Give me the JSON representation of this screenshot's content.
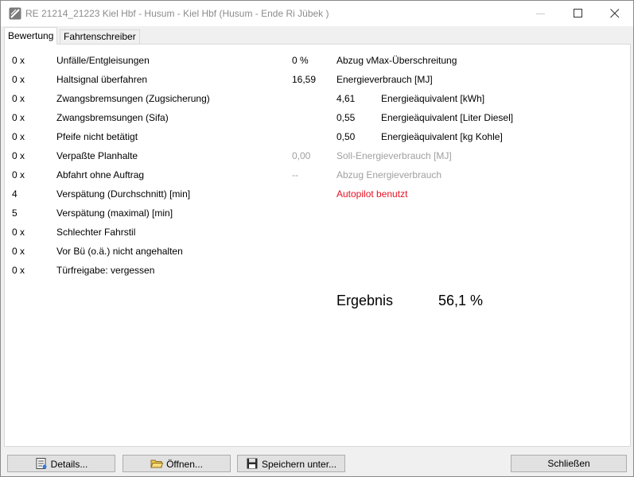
{
  "window": {
    "title": "RE 21214_21223 Kiel Hbf - Husum - Kiel Hbf (Husum - Ende Ri Jübek )"
  },
  "tabs": [
    {
      "label": "Bewertung"
    },
    {
      "label": "Fahrtenschreiber"
    }
  ],
  "left_rows": [
    {
      "value": "0 x",
      "label": "Unfälle/Entgleisungen"
    },
    {
      "value": "0 x",
      "label": "Haltsignal überfahren"
    },
    {
      "value": "0 x",
      "label": "Zwangsbremsungen (Zugsicherung)"
    },
    {
      "value": "0 x",
      "label": "Zwangsbremsungen (Sifa)"
    },
    {
      "value": "0 x",
      "label": "Pfeife nicht betätigt"
    },
    {
      "value": "0 x",
      "label": "Verpaßte Planhalte"
    },
    {
      "value": "0 x",
      "label": "Abfahrt ohne Auftrag"
    },
    {
      "value": "4",
      "label": "Verspätung (Durchschnitt) [min]"
    },
    {
      "value": "5",
      "label": "Verspätung (maximal) [min]"
    },
    {
      "value": "0 x",
      "label": "Schlechter Fahrstil"
    },
    {
      "value": "0 x",
      "label": "Vor Bü (o.ä.) nicht angehalten"
    },
    {
      "value": "0 x",
      "label": "Türfreigabe: vergessen"
    }
  ],
  "right": {
    "vmax": {
      "value": "0 %",
      "label": "Abzug vMax-Überschreitung"
    },
    "energy": {
      "value": "16,59",
      "label": "Energieverbrauch [MJ]"
    },
    "equivalents": [
      {
        "value": "4,61",
        "label": "Energieäquivalent [kWh]"
      },
      {
        "value": "0,55",
        "label": "Energieäquivalent [Liter Diesel]"
      },
      {
        "value": "0,50",
        "label": "Energieäquivalent [kg Kohle]"
      }
    ],
    "soll": {
      "value": "0,00",
      "label": "Soll-Energieverbrauch [MJ]"
    },
    "abzug": {
      "value": "--",
      "label": "Abzug Energieverbrauch"
    },
    "autopilot": "Autopilot benutzt",
    "ergebnis_label": "Ergebnis",
    "ergebnis_value": "56,1 %"
  },
  "buttons": {
    "details": "Details...",
    "open": "Öffnen...",
    "save": "Speichern unter...",
    "close": "Schließen"
  },
  "colors": {
    "warning": "#e81123",
    "disabled": "#a0a0a0"
  }
}
